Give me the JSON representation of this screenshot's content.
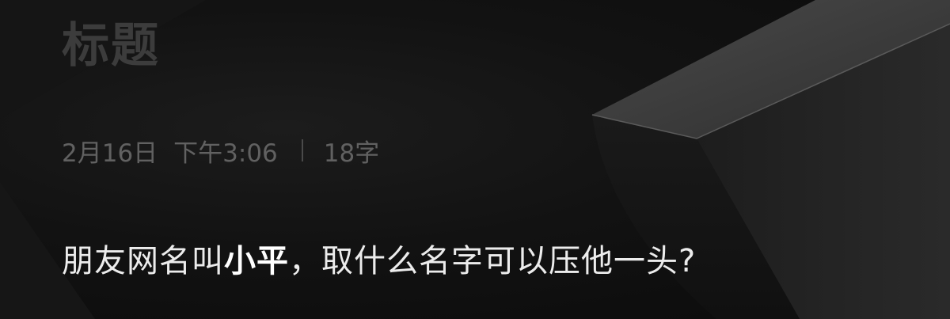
{
  "note": {
    "title_placeholder": "标题",
    "date": "2月16日",
    "time": "下午3:06",
    "char_count": "18字",
    "body": {
      "before": "朋友网名叫",
      "emphasis": "小平",
      "after": "，取什么名字可以压他一头?"
    }
  },
  "colors": {
    "background": "#121212",
    "title_placeholder": "#3c3c3c",
    "meta_text": "#616161",
    "body_text": "#ececec"
  }
}
